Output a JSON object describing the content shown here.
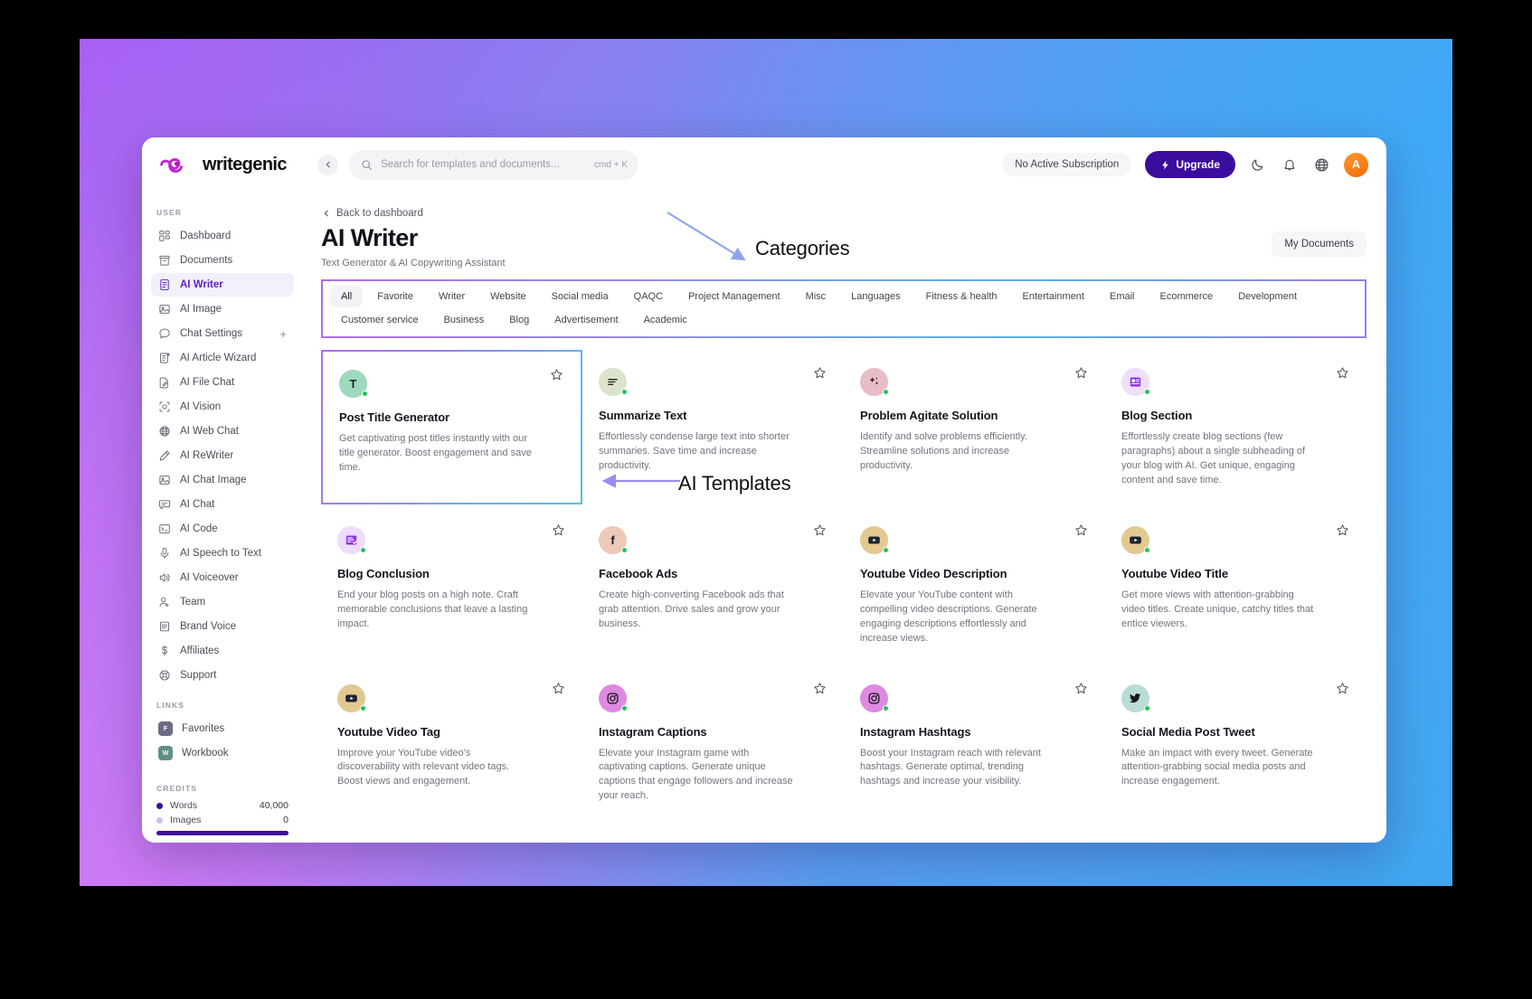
{
  "app": {
    "brand": "writegenic",
    "collapse_icon": "chevron-left-icon"
  },
  "search": {
    "placeholder": "Search for templates and documents...",
    "value": "",
    "shortcut": "cmd + K",
    "icon": "search-icon"
  },
  "topbar": {
    "subscription_status": "No Active Subscription",
    "upgrade_label": "Upgrade",
    "upgrade_icon": "bolt-icon",
    "theme_icon": "moon-icon",
    "notification_icon": "bell-icon",
    "language_icon": "globe-icon",
    "avatar_initial": "A",
    "accent": "#3b0d9e"
  },
  "sidebar": {
    "user_section_label": "USER",
    "links_section_label": "LINKS",
    "credits_section_label": "CREDITS",
    "items": [
      {
        "label": "Dashboard",
        "icon": "grid-icon",
        "active": false
      },
      {
        "label": "Documents",
        "icon": "archive-icon",
        "active": false
      },
      {
        "label": "AI Writer",
        "icon": "document-text-icon",
        "active": true
      },
      {
        "label": "AI Image",
        "icon": "image-icon",
        "active": false
      },
      {
        "label": "Chat Settings",
        "icon": "chat-bubble-icon",
        "active": false,
        "trailing": "+"
      },
      {
        "label": "AI Article Wizard",
        "icon": "article-wizard-icon",
        "active": false
      },
      {
        "label": "AI File Chat",
        "icon": "file-pencil-icon",
        "active": false
      },
      {
        "label": "AI Vision",
        "icon": "eye-scan-icon",
        "active": false
      },
      {
        "label": "AI Web Chat",
        "icon": "globe-icon",
        "active": false
      },
      {
        "label": "AI ReWriter",
        "icon": "pencil-icon",
        "active": false
      },
      {
        "label": "AI Chat Image",
        "icon": "image-icon",
        "active": false
      },
      {
        "label": "AI Chat",
        "icon": "chat-lines-icon",
        "active": false
      },
      {
        "label": "AI Code",
        "icon": "terminal-icon",
        "active": false
      },
      {
        "label": "AI Speech to Text",
        "icon": "microphone-icon",
        "active": false
      },
      {
        "label": "AI Voiceover",
        "icon": "speaker-icon",
        "active": false
      },
      {
        "label": "Team",
        "icon": "user-plus-icon",
        "active": false
      },
      {
        "label": "Brand Voice",
        "icon": "brand-voice-icon",
        "active": false
      },
      {
        "label": "Affiliates",
        "icon": "dollar-icon",
        "active": false
      },
      {
        "label": "Support",
        "icon": "lifebuoy-icon",
        "active": false
      }
    ],
    "links": [
      {
        "label": "Favorites",
        "badge": "F",
        "color": "#6b6b85"
      },
      {
        "label": "Workbook",
        "badge": "W",
        "color": "#5f8f87"
      }
    ],
    "credits": [
      {
        "label": "Words",
        "value": "40,000",
        "color": "#3b0d9e"
      },
      {
        "label": "Images",
        "value": "0",
        "color": "#cdbdf0"
      }
    ]
  },
  "main": {
    "back_label": "Back to dashboard",
    "back_icon": "chevron-left-icon",
    "title": "AI Writer",
    "subtitle": "Text Generator & AI Copywriting Assistant",
    "my_documents_label": "My Documents"
  },
  "categories": {
    "selected": "All",
    "items": [
      "All",
      "Favorite",
      "Writer",
      "Website",
      "Social media",
      "QAQC",
      "Project Management",
      "Misc",
      "Languages",
      "Fitness & health",
      "Entertainment",
      "Email",
      "Ecommerce",
      "Development",
      "Customer service",
      "Business",
      "Blog",
      "Advertisement",
      "Academic"
    ]
  },
  "annotations": [
    {
      "text": "Categories",
      "target": "categories-bar"
    },
    {
      "text": "AI Templates",
      "target": "template-card"
    }
  ],
  "templates": [
    {
      "title": "Post Title Generator",
      "description": "Get captivating post titles instantly with our title generator. Boost engagement and save time.",
      "icon": "letter-t-icon",
      "icon_glyph": "T",
      "icon_bg": "#9ed8bd",
      "icon_fg": "#1d2a24",
      "highlighted": true,
      "favorite": false,
      "star_icon": "star-outline-icon"
    },
    {
      "title": "Summarize Text",
      "description": "Effortlessly condense large text into shorter summaries. Save time and increase productivity.",
      "icon": "text-lines-icon",
      "icon_glyph": "",
      "icon_bg": "#dbe3cb",
      "icon_fg": "#22251c",
      "highlighted": false,
      "favorite": false,
      "star_icon": "star-outline-icon"
    },
    {
      "title": "Problem Agitate Solution",
      "description": "Identify and solve problems efficiently. Streamline solutions and increase productivity.",
      "icon": "sparkles-icon",
      "icon_glyph": "",
      "icon_bg": "#e8bdc6",
      "icon_fg": "#1a1a22",
      "highlighted": false,
      "favorite": false,
      "star_icon": "star-outline-icon"
    },
    {
      "title": "Blog Section",
      "description": "Effortlessly create blog sections (few paragraphs) about a single subheading of your blog with AI. Get unique, engaging content and save time.",
      "icon": "blog-section-icon",
      "icon_glyph": "",
      "icon_bg": "#eddffb",
      "icon_fg": "#8b2ff0",
      "highlighted": false,
      "favorite": false,
      "star_icon": "star-outline-icon"
    },
    {
      "title": "Blog Conclusion",
      "description": "End your blog posts on a high note. Craft memorable conclusions that leave a lasting impact.",
      "icon": "blog-conclusion-icon",
      "icon_glyph": "",
      "icon_bg": "#eddcfb",
      "icon_fg": "#8b2ff0",
      "highlighted": false,
      "favorite": false,
      "star_icon": "star-outline-icon"
    },
    {
      "title": "Facebook Ads",
      "description": "Create high-converting Facebook ads that grab attention. Drive sales and grow your business.",
      "icon": "facebook-icon",
      "icon_glyph": "f",
      "icon_bg": "#edc9b8",
      "icon_fg": "#15151e",
      "highlighted": false,
      "favorite": false,
      "star_icon": "star-outline-icon"
    },
    {
      "title": "Youtube Video Description",
      "description": "Elevate your YouTube content with compelling video descriptions. Generate engaging descriptions effortlessly and increase views.",
      "icon": "youtube-icon",
      "icon_glyph": "",
      "icon_bg": "#e2c992",
      "icon_fg": "#1c1c26",
      "highlighted": false,
      "favorite": false,
      "star_icon": "star-outline-icon"
    },
    {
      "title": "Youtube Video Title",
      "description": "Get more views with attention-grabbing video titles. Create unique, catchy titles that entice viewers.",
      "icon": "youtube-icon",
      "icon_glyph": "",
      "icon_bg": "#e2c992",
      "icon_fg": "#1c1c26",
      "highlighted": false,
      "favorite": false,
      "star_icon": "star-outline-icon"
    },
    {
      "title": "Youtube Video Tag",
      "description": "Improve your YouTube video's discoverability with relevant video tags. Boost views and engagement.",
      "icon": "youtube-icon",
      "icon_glyph": "",
      "icon_bg": "#e2c992",
      "icon_fg": "#1c1c26",
      "highlighted": false,
      "favorite": false,
      "star_icon": "star-outline-icon"
    },
    {
      "title": "Instagram Captions",
      "description": "Elevate your Instagram game with captivating captions. Generate unique captions that engage followers and increase your reach.",
      "icon": "instagram-icon",
      "icon_glyph": "",
      "icon_bg": "#dd8ae0",
      "icon_fg": "#15151e",
      "highlighted": false,
      "favorite": false,
      "star_icon": "star-outline-icon"
    },
    {
      "title": "Instagram Hashtags",
      "description": "Boost your Instagram reach with relevant hashtags. Generate optimal, trending hashtags and increase your visibility.",
      "icon": "instagram-icon",
      "icon_glyph": "",
      "icon_bg": "#dd8ae0",
      "icon_fg": "#15151e",
      "highlighted": false,
      "favorite": false,
      "star_icon": "star-outline-icon"
    },
    {
      "title": "Social Media Post Tweet",
      "description": "Make an impact with every tweet. Generate attention-grabbing social media posts and increase engagement.",
      "icon": "twitter-icon",
      "icon_glyph": "",
      "icon_bg": "#b9dcd6",
      "icon_fg": "#15151e",
      "highlighted": false,
      "favorite": false,
      "star_icon": "star-outline-icon"
    }
  ]
}
